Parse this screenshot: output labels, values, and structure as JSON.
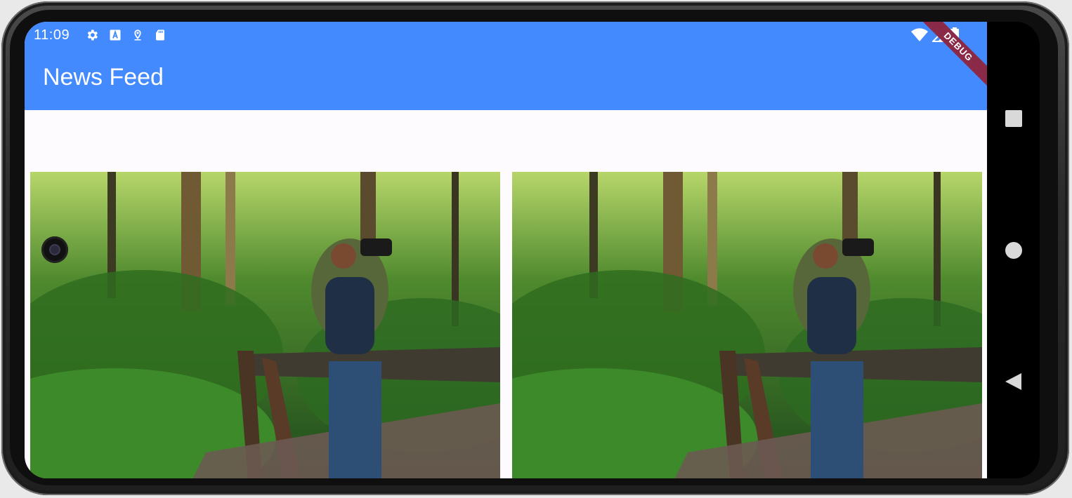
{
  "status_bar": {
    "time": "11:09",
    "left_icons": [
      "settings-icon",
      "a-icon",
      "location-icon",
      "sd-card-icon"
    ],
    "right_icons": [
      "wifi-icon",
      "signal-icon",
      "battery-icon"
    ],
    "debug_label": "DEBUG"
  },
  "app_bar": {
    "title": "News Feed",
    "color": "#448aff"
  },
  "feed": {
    "items": [
      {
        "image": "forest-photographer-image"
      },
      {
        "image": "forest-photographer-image"
      }
    ]
  },
  "nav_bar": {
    "buttons": [
      "recents-square-icon",
      "home-circle-icon",
      "back-triangle-icon"
    ]
  }
}
